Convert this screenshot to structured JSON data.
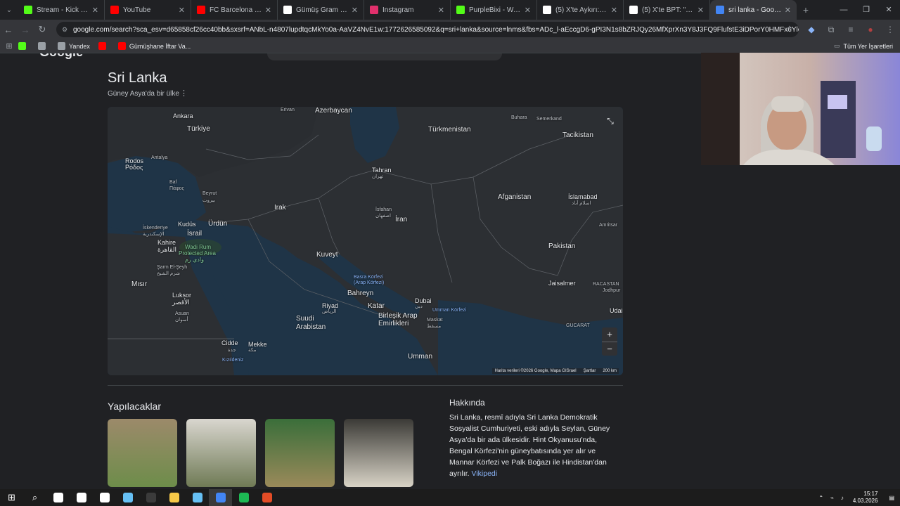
{
  "browser": {
    "tabs": [
      {
        "title": "Stream - Kick Dashbo",
        "color": "#53fc18"
      },
      {
        "title": "YouTube",
        "color": "#ff0000"
      },
      {
        "title": "FC Barcelona - Atletic",
        "color": "#ff0000"
      },
      {
        "title": "Gümüş Gram Fiyatı C",
        "color": "#ffffff"
      },
      {
        "title": "Instagram",
        "color": "#e1306c"
      },
      {
        "title": "PurpleBixi - Watch th",
        "color": "#53fc18"
      },
      {
        "title": "(5) X'te Aykırı: \"SON",
        "color": "#ffffff"
      },
      {
        "title": "(5) X'te BPT: \"Hatay D",
        "color": "#ffffff"
      },
      {
        "title": "sri lanka - Google'da",
        "color": "#4285f4"
      }
    ],
    "url": "google.com/search?sca_esv=d65858cf26cc40bb&sxsrf=ANbL-n4807lupdtqcMkYo0a-AaVZ4NvE1w:1772626585092&q=sri+lanka&source=lnms&fbs=ADc_l-aEccgD6-gPI3N1s8bZRJQy26MfXprXn3Y8J3FQ9FlufstE3iDPorY0HMFx6YloUXyBiDurQk...",
    "bookmarks": [
      {
        "label": "",
        "color": "#53fc18"
      },
      {
        "label": "",
        "color": "#9aa0a6"
      },
      {
        "label": "Yandex",
        "color": "#9aa0a6"
      },
      {
        "label": "",
        "color": "#ff0000"
      },
      {
        "label": "Gümüşhane İftar Va...",
        "color": "#ff0000"
      }
    ],
    "all_bookmarks": "Tüm Yer İşaretleri"
  },
  "page": {
    "logo_fragment": "Google",
    "title": "Sri Lanka",
    "subtitle": "Güney Asya'da bir ülke",
    "map": {
      "labels": [
        {
          "t": "Ankara",
          "c": ""
        },
        {
          "t": "Erivan",
          "c": "sm"
        },
        {
          "t": "Azerbaycan",
          "c": "big"
        },
        {
          "t": "Türkmenistan",
          "c": "big"
        },
        {
          "t": "Buhara",
          "c": "sm"
        },
        {
          "t": "Semerkand",
          "c": "sm"
        },
        {
          "t": "Tacikistan",
          "c": "big"
        },
        {
          "t": "Türkiye",
          "c": "big"
        },
        {
          "t": "Rodos",
          "c": ""
        },
        {
          "t": "Ρόδος",
          "c": ""
        },
        {
          "t": "Antalya",
          "c": "sm"
        },
        {
          "t": "Tahran",
          "c": ""
        },
        {
          "t": "تهران",
          "c": "sm"
        },
        {
          "t": "Baf",
          "c": "sm"
        },
        {
          "t": "Πάφος",
          "c": "sm"
        },
        {
          "t": "Beyrut",
          "c": "sm"
        },
        {
          "t": "بيروت",
          "c": "sm"
        },
        {
          "t": "Afganistan",
          "c": "big"
        },
        {
          "t": "İslamabad",
          "c": ""
        },
        {
          "t": "اسلام آباد",
          "c": "sm"
        },
        {
          "t": "Irak",
          "c": "big"
        },
        {
          "t": "İsfahan",
          "c": "sm"
        },
        {
          "t": "اصفهان",
          "c": "sm"
        },
        {
          "t": "İran",
          "c": "big"
        },
        {
          "t": "Kudüs",
          "c": ""
        },
        {
          "t": "Ürdün",
          "c": "big"
        },
        {
          "t": "İskenderiye",
          "c": "sm"
        },
        {
          "t": "الإسكندرية",
          "c": "sm"
        },
        {
          "t": "İsrail",
          "c": "big"
        },
        {
          "t": "Amritsar",
          "c": "sm"
        },
        {
          "t": "Kahire",
          "c": ""
        },
        {
          "t": "القاهرة",
          "c": ""
        },
        {
          "t": "Wadi Rum",
          "c": "park"
        },
        {
          "t": "Protected Area",
          "c": "park"
        },
        {
          "t": "وادي رم",
          "c": "park"
        },
        {
          "t": "Pakistan",
          "c": "big"
        },
        {
          "t": "Kuveyt",
          "c": "big"
        },
        {
          "t": "Şarm El-Şeyh",
          "c": "sm"
        },
        {
          "t": "شرم الشيخ",
          "c": "sm"
        },
        {
          "t": "Basra Körfezi",
          "c": "sea"
        },
        {
          "t": "(Arap Körfezi)",
          "c": "sea"
        },
        {
          "t": "Mısır",
          "c": "big"
        },
        {
          "t": "Jaisalmer",
          "c": ""
        },
        {
          "t": "RACASTAN",
          "c": "sm"
        },
        {
          "t": "Jodhpur",
          "c": "sm"
        },
        {
          "t": "Luksor",
          "c": ""
        },
        {
          "t": "الأقصر",
          "c": ""
        },
        {
          "t": "Bahreyn",
          "c": "big"
        },
        {
          "t": "Dubai",
          "c": ""
        },
        {
          "t": "دبي",
          "c": "sm"
        },
        {
          "t": "Umman Körfezi",
          "c": "sea"
        },
        {
          "t": "Riyad",
          "c": ""
        },
        {
          "t": "الرياض",
          "c": "sm"
        },
        {
          "t": "Katar",
          "c": "big"
        },
        {
          "t": "Udai",
          "c": ""
        },
        {
          "t": "Asuan",
          "c": "sm"
        },
        {
          "t": "أسوان",
          "c": "sm"
        },
        {
          "t": "Birleşik Arap",
          "c": "big"
        },
        {
          "t": "Emirlikleri",
          "c": "big"
        },
        {
          "t": "Maskat",
          "c": "sm"
        },
        {
          "t": "مسقط",
          "c": "sm"
        },
        {
          "t": "Suudi",
          "c": "big"
        },
        {
          "t": "Arabistan",
          "c": "big"
        },
        {
          "t": "GUCARAT",
          "c": "sm"
        },
        {
          "t": "Cidde",
          "c": ""
        },
        {
          "t": "جدة",
          "c": "sm"
        },
        {
          "t": "Mekke",
          "c": ""
        },
        {
          "t": "مكة",
          "c": "sm"
        },
        {
          "t": "Kızıldeniz",
          "c": "sea"
        },
        {
          "t": "Umman",
          "c": "big"
        }
      ],
      "attribution": "Harita verileri ©2026 Google, Mapa GISrael",
      "terms": "Şartlar",
      "scale": "200 km",
      "zoom_in": "+",
      "zoom_out": "−"
    },
    "things_to_do_title": "Yapılacaklar",
    "thumbs": [
      {
        "color_top": "#9c8a6a",
        "color_bottom": "#6d8d4a"
      },
      {
        "color_top": "#d9d6cf",
        "color_bottom": "#6f7a55"
      },
      {
        "color_top": "#3a6e3a",
        "color_bottom": "#9a8a5a"
      },
      {
        "color_top": "#3b3a36",
        "color_bottom": "#d8d3c6"
      }
    ],
    "about_title": "Hakkında",
    "about_text": "Sri Lanka, resmî adıyla Sri Lanka Demokratik Sosyalist Cumhuriyeti, eski adıyla Seylan, Güney Asya'da bir ada ülkesidir. Hint Okyanusu'nda, Bengal Körfezi'nin güneybatısında yer alır ve Mannar Körfezi ve Palk Boğazı ile Hindistan'dan ayrılır.",
    "about_link": "Vikipedi"
  },
  "taskbar": {
    "time": "15:17",
    "date": "4.03.2026",
    "apps": [
      "#ffffff",
      "#ffffff",
      "#ffffff",
      "#66c0f4",
      "#3b3b3b",
      "#f7c948",
      "#66c0f4",
      "#4285f4",
      "#1db954",
      "#e34c26"
    ]
  }
}
